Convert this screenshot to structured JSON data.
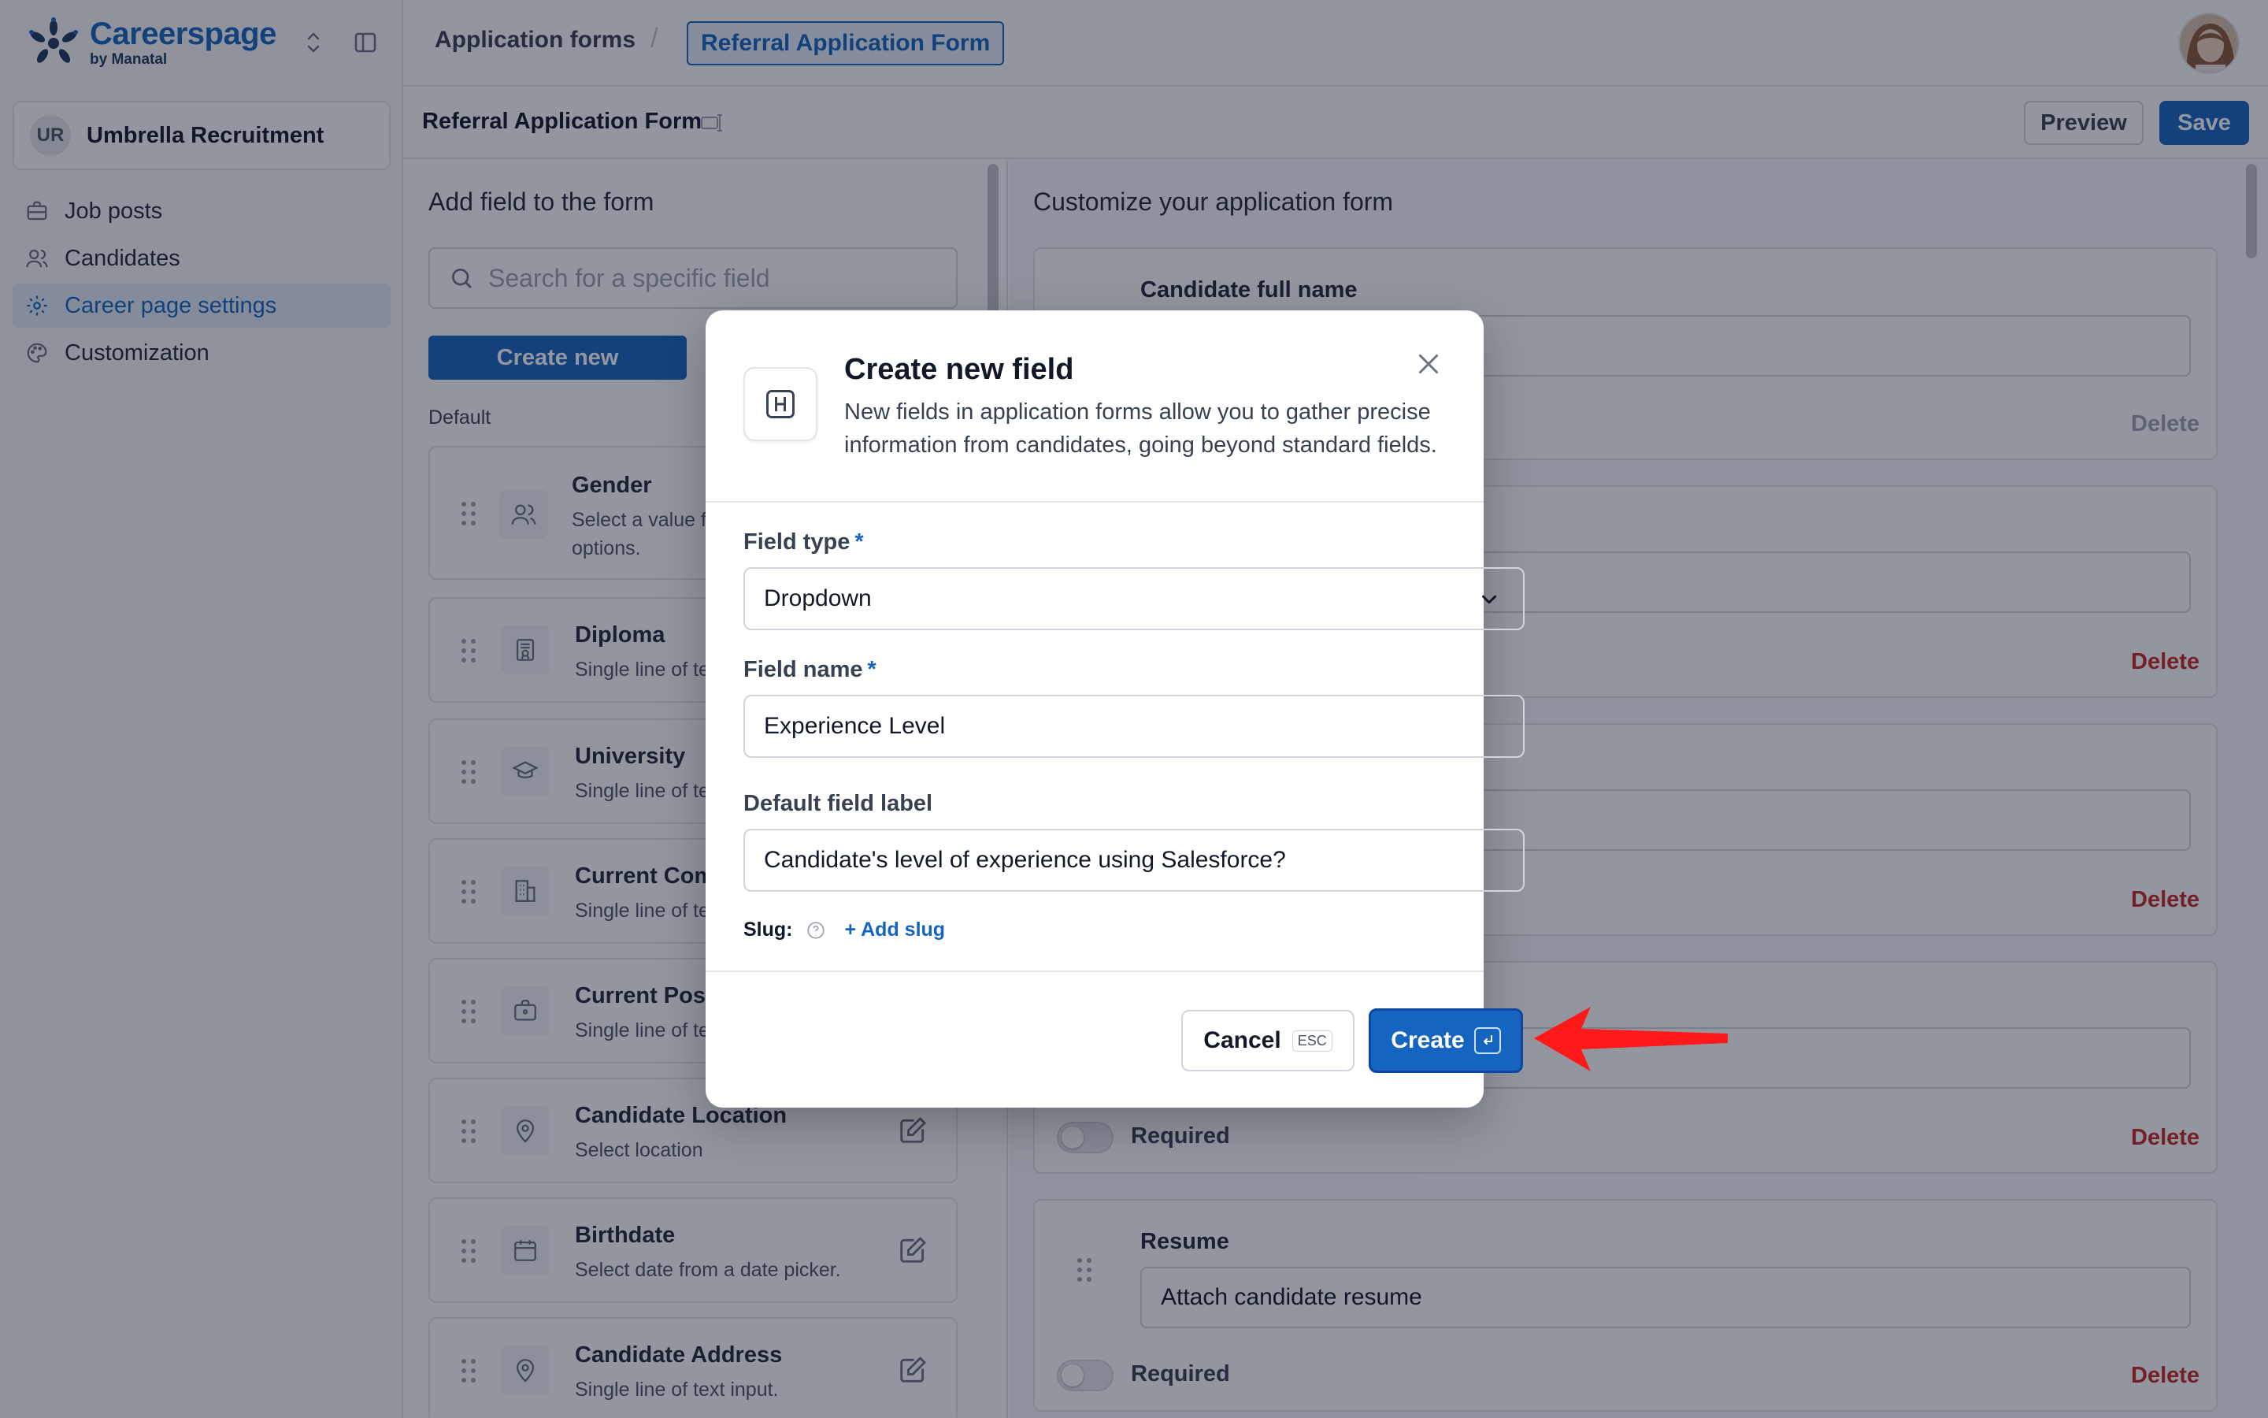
{
  "brand": {
    "name": "Careerspage",
    "sub": "by Manatal"
  },
  "org": {
    "initials": "UR",
    "name": "Umbrella Recruitment"
  },
  "sidebar": {
    "items": [
      {
        "label": "Job posts",
        "icon": "briefcase-icon"
      },
      {
        "label": "Candidates",
        "icon": "users-icon"
      },
      {
        "label": "Career page settings",
        "icon": "gear-icon",
        "active": true
      },
      {
        "label": "Customization",
        "icon": "palette-icon"
      }
    ]
  },
  "breadcrumb": {
    "parent": "Application forms",
    "separator": "/",
    "current": "Referral Application Form"
  },
  "subheader": {
    "title": "Referral Application Form",
    "preview_label": "Preview",
    "save_label": "Save"
  },
  "left_panel": {
    "heading": "Add field to the form",
    "search_placeholder": "Search for a specific field",
    "create_new_label": "Create new",
    "section_label": "Default",
    "fields": [
      {
        "title": "Gender",
        "desc_line1": "Select a value f",
        "desc_line2": "options.",
        "icon": "user-pair-icon"
      },
      {
        "title": "Diploma",
        "desc_line1": "Single line of te",
        "icon": "certificate-icon"
      },
      {
        "title": "University",
        "desc_line1": "Single line of te",
        "icon": "graduation-cap-icon"
      },
      {
        "title": "Current Com",
        "desc_line1": "Single line of te",
        "icon": "building-icon"
      },
      {
        "title": "Current Posi",
        "desc_line1": "Single line of te",
        "icon": "briefcase-icon"
      },
      {
        "title": "Candidate Location",
        "desc_line1": "Select location",
        "icon": "map-pin-icon"
      },
      {
        "title": "Birthdate",
        "desc_line1": "Select date from a date picker.",
        "icon": "calendar-icon"
      },
      {
        "title": "Candidate Address",
        "desc_line1": "Single line of text input.",
        "icon": "map-pin-icon"
      }
    ]
  },
  "right_panel": {
    "heading": "Customize your application form",
    "cards": [
      {
        "label": "Candidate full name",
        "value": "",
        "delete_label": "Delete"
      },
      {
        "label": "",
        "value": "",
        "delete_label": "Delete"
      },
      {
        "label": "",
        "value": "",
        "delete_label": "Delete"
      },
      {
        "label": "",
        "value": "",
        "required_label": "Required",
        "delete_label": "Delete"
      },
      {
        "label": "Resume",
        "value": "Attach candidate resume",
        "required_label": "Required",
        "delete_label": "Delete"
      }
    ]
  },
  "modal": {
    "icon": "heading-icon",
    "title": "Create new field",
    "description": "New fields in application forms allow you to gather precise information from candidates, going beyond standard fields.",
    "field_type_label": "Field type",
    "field_type_value": "Dropdown",
    "field_name_label": "Field name",
    "field_name_value": "Experience Level",
    "default_label_label": "Default field label",
    "default_label_value": "Candidate's level of experience using Salesforce?",
    "required_mark": "*",
    "slug_label": "Slug:",
    "add_slug_label": "+ Add slug",
    "cancel_label": "Cancel",
    "cancel_key": "ESC",
    "create_label": "Create"
  },
  "colors": {
    "accent": "#1565c0",
    "delete": "#c62828",
    "annotation_arrow": "#ff1a1a"
  }
}
